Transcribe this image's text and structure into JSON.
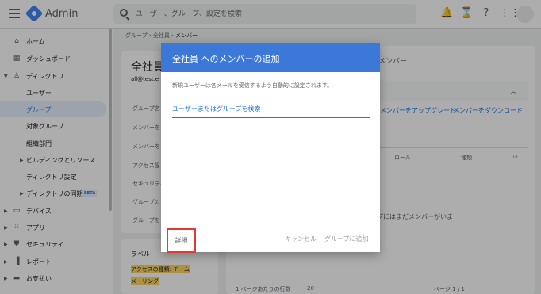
{
  "topbar": {
    "app_title": "Admin",
    "search_placeholder": "ユーザー、グループ、設定を検索"
  },
  "sidebar": {
    "items": [
      {
        "label": "ホーム",
        "icon": "home-icon"
      },
      {
        "label": "ダッシュボード",
        "icon": "dashboard-icon"
      },
      {
        "label": "ディレクトリ",
        "icon": "person-icon"
      },
      {
        "label": "ユーザー"
      },
      {
        "label": "グループ"
      },
      {
        "label": "対象グループ"
      },
      {
        "label": "組織部門"
      },
      {
        "label": "ビルディングとリソース"
      },
      {
        "label": "ディレクトリ設定"
      },
      {
        "label": "ディレクトリの同期"
      },
      {
        "label": "デバイス",
        "icon": "devices-icon"
      },
      {
        "label": "アプリ",
        "icon": "apps-icon"
      },
      {
        "label": "セキュリティ",
        "icon": "shield-icon"
      },
      {
        "label": "レポート",
        "icon": "bar-chart-icon"
      },
      {
        "label": "お支払い",
        "icon": "credit-card-icon"
      }
    ],
    "beta_badge": "BETA"
  },
  "breadcrumb": {
    "items": [
      "グループ",
      "全社員",
      "メンバー"
    ]
  },
  "group_info": {
    "title": "全社員",
    "email": "all@test.e",
    "items": [
      "グループ名",
      "メンバーを",
      "メンバーを",
      "アクセス設",
      "セキュリティ",
      "グループの",
      "グループを"
    ]
  },
  "labels_card": {
    "title": "ラベル",
    "line1": "アクセスの種類: チーム",
    "line2": "メーリング"
  },
  "members": {
    "title": "メンバー",
    "upgrade_link": "メンバーをアップグレード",
    "download_link": "メンバーをダウンロード",
    "col_role": "ロール",
    "col_type": "種類",
    "empty_text": "プにはまだメンバーがいま",
    "rows_per_page": "1 ページあたりの行数",
    "rows_value": "20",
    "page_text": "ページ 1 / 1"
  },
  "dialog": {
    "title": "全社員 へのメンバーの追加",
    "description": "新規ユーザーは各メールを受信するよう自動的に設定されます。",
    "search_placeholder": "ユーザーまたはグループを検索",
    "details_button": "詳細",
    "cancel_button": "キャンセル",
    "add_button": "グループに追加"
  },
  "colors": {
    "dialog_header": "#3c78d8",
    "accent": "#1a73e8",
    "highlight_border": "#e53935"
  }
}
